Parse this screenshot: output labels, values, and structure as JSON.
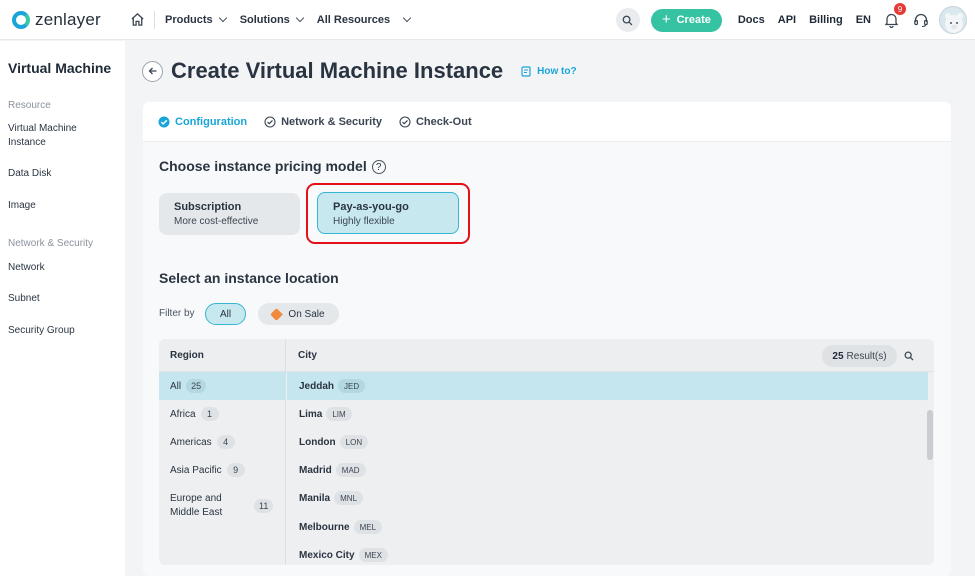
{
  "header": {
    "logo_text": "zenlayer",
    "nav": [
      {
        "label": "Products"
      },
      {
        "label": "Solutions"
      },
      {
        "label": "All Resources"
      }
    ],
    "create_label": "Create",
    "links": [
      "Docs",
      "API",
      "Billing",
      "EN"
    ],
    "notification_count": "9"
  },
  "sidebar": {
    "title": "Virtual Machine",
    "groups": [
      {
        "label": "Resource",
        "items": [
          "Virtual Machine Instance",
          "Data Disk",
          "Image"
        ]
      },
      {
        "label": "Network & Security",
        "items": [
          "Network",
          "Subnet",
          "Security Group"
        ]
      }
    ]
  },
  "page": {
    "title": "Create Virtual Machine Instance",
    "howto": "How to?"
  },
  "steps": [
    "Configuration",
    "Network & Security",
    "Check-Out"
  ],
  "pricing": {
    "title": "Choose instance pricing model",
    "options": [
      {
        "name": "Subscription",
        "desc": "More cost-effective"
      },
      {
        "name": "Pay-as-you-go",
        "desc": "Highly flexible"
      }
    ]
  },
  "location": {
    "title": "Select an instance location",
    "filter_label": "Filter by",
    "filters": [
      "All",
      "On Sale"
    ],
    "region_header": "Region",
    "city_header": "City",
    "result_count": "25",
    "result_suffix": "Result(s)",
    "regions": [
      {
        "name": "All",
        "count": "25"
      },
      {
        "name": "Africa",
        "count": "1"
      },
      {
        "name": "Americas",
        "count": "4"
      },
      {
        "name": "Asia Pacific",
        "count": "9"
      },
      {
        "name": "Europe and Middle East",
        "count": "11"
      }
    ],
    "cities": [
      {
        "name": "Jeddah",
        "code": "JED"
      },
      {
        "name": "Lima",
        "code": "LIM"
      },
      {
        "name": "London",
        "code": "LON"
      },
      {
        "name": "Madrid",
        "code": "MAD"
      },
      {
        "name": "Manila",
        "code": "MNL"
      },
      {
        "name": "Melbourne",
        "code": "MEL"
      },
      {
        "name": "Mexico City",
        "code": "MEX"
      }
    ]
  },
  "colors": {
    "accent": "#1aa5d8",
    "create": "#35c3a3",
    "highlight": "#e3101a"
  }
}
